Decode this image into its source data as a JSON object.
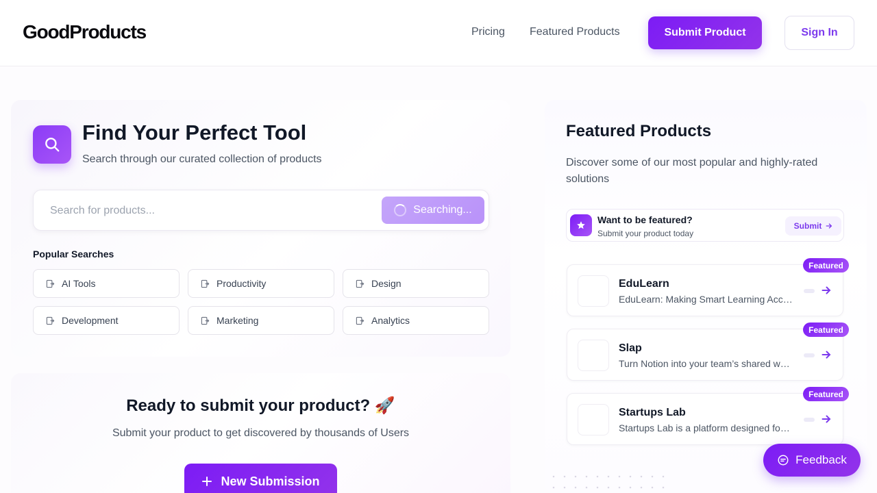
{
  "header": {
    "logo": "GoodProducts",
    "nav": [
      "Pricing",
      "Featured Products"
    ],
    "submit_label": "Submit Product",
    "signin_label": "Sign In"
  },
  "search": {
    "title": "Find Your Perfect Tool",
    "subtitle": "Search through our curated collection of products",
    "placeholder": "Search for products...",
    "button_label": "Searching...",
    "popular_label": "Popular Searches",
    "chips": [
      "AI Tools",
      "Productivity",
      "Design",
      "Development",
      "Marketing",
      "Analytics"
    ]
  },
  "submit_section": {
    "title": "Ready to submit your product? 🚀",
    "subtitle": "Submit your product to get discovered by thousands of Users",
    "button_label": "New Submission"
  },
  "featured": {
    "title": "Featured Products",
    "subtitle": "Discover some of our most popular and highly-rated solutions",
    "promo": {
      "title": "Want to be featured?",
      "subtitle": "Submit your product today",
      "button_label": "Submit"
    },
    "badge_label": "Featured",
    "products": [
      {
        "name": "EduLearn",
        "description": "EduLearn: Making Smart Learning Accessible"
      },
      {
        "name": "Slap",
        "description": "Turn Notion into your team’s shared workspace"
      },
      {
        "name": "Startups Lab",
        "description": "Startups Lab is a platform designed for founders"
      }
    ]
  },
  "feedback_label": "Feedback",
  "colors": {
    "accent": "#7c3aed",
    "accent_gradient_start": "#7c1cf5",
    "text_primary": "#111827",
    "text_secondary": "#4b5563"
  }
}
